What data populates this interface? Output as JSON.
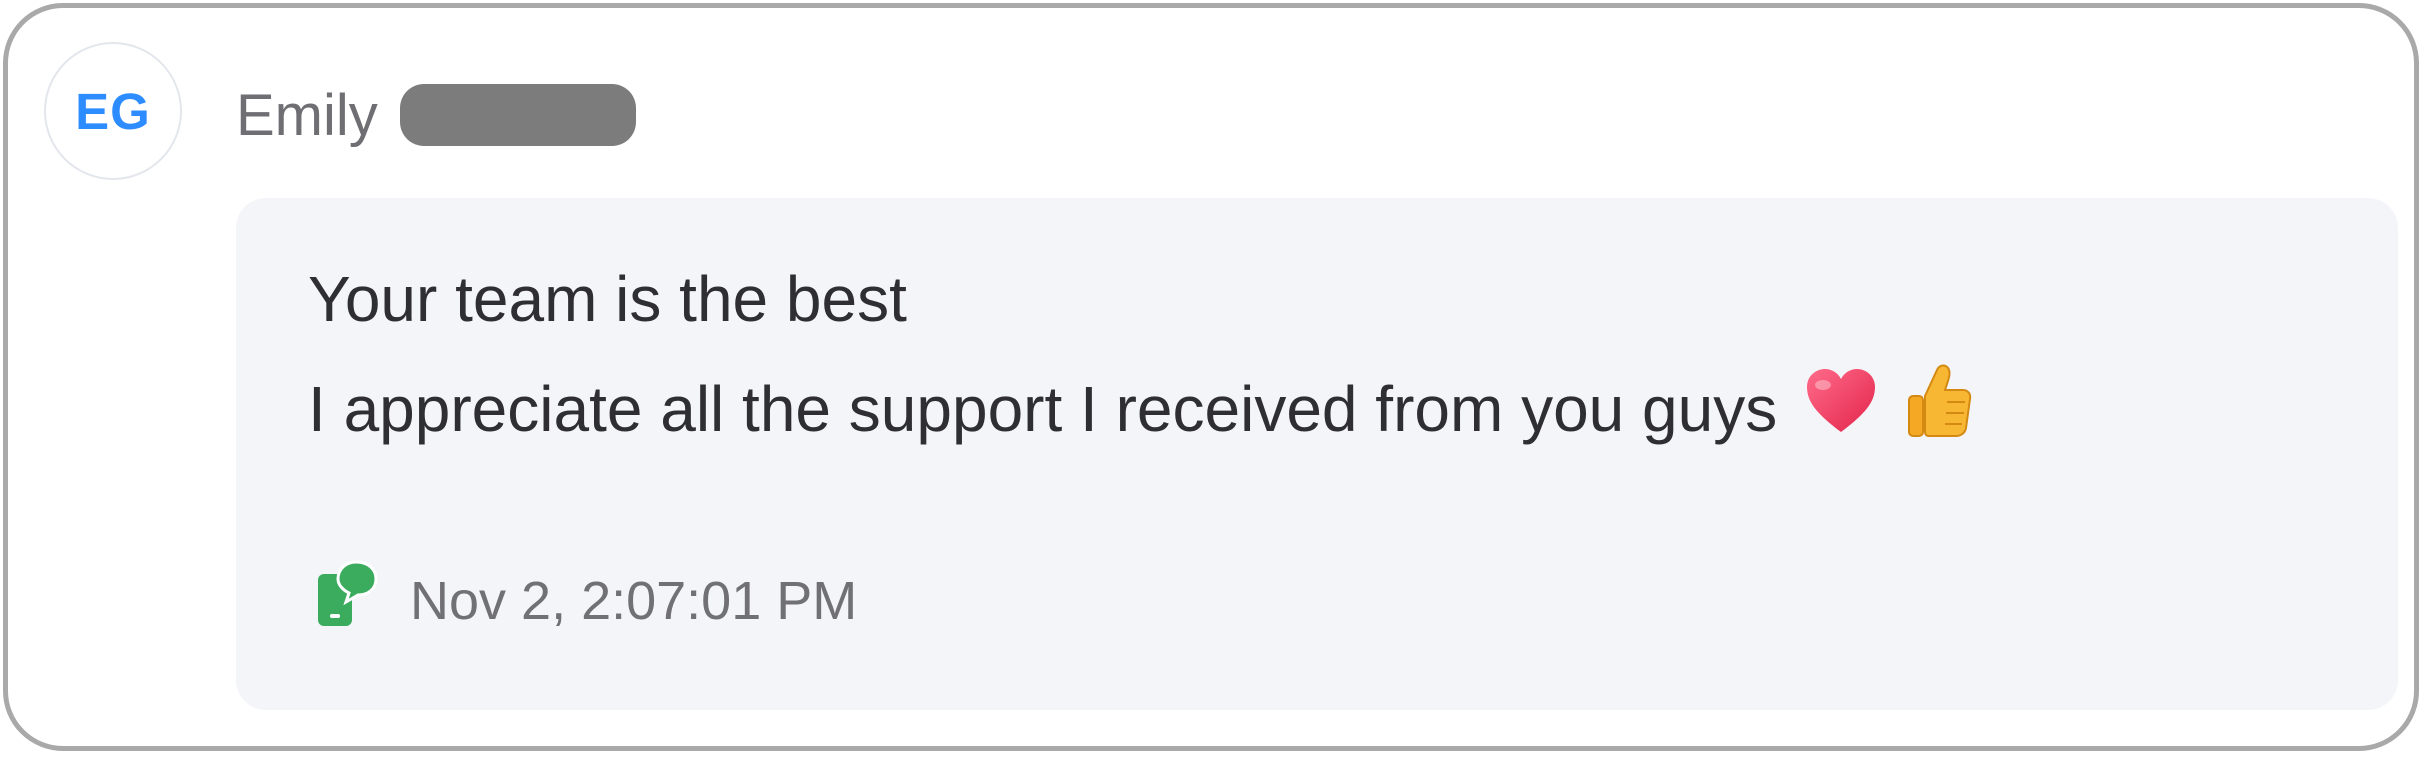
{
  "message": {
    "sender": {
      "initials": "EG",
      "name": "Emily",
      "avatar_color": "#2d8cff"
    },
    "lines": [
      "Your team is the best",
      "I appreciate all the support I received from you guys"
    ],
    "emojis": [
      "heart-icon",
      "thumbs-up-icon"
    ],
    "channel_icon": "sms-phone-chat-icon",
    "channel_color": "#3bab5e",
    "timestamp": "Nov 2, 2:07:01 PM"
  }
}
